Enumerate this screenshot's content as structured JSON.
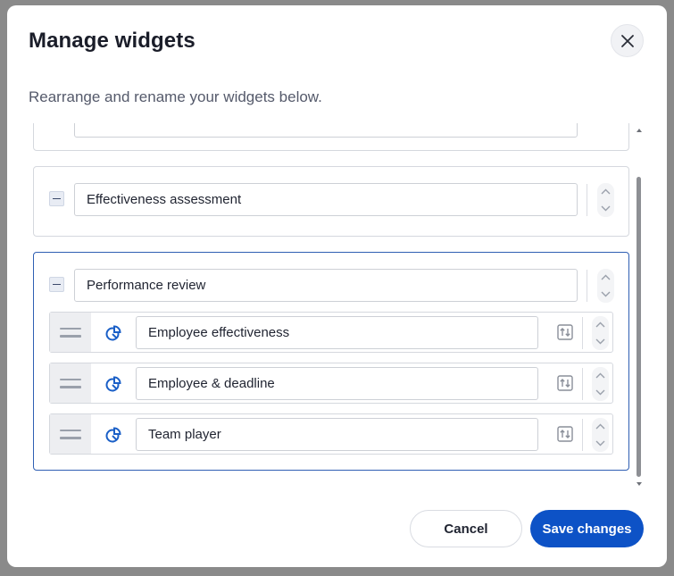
{
  "dialog": {
    "title": "Manage widgets",
    "subtitle": "Rearrange and rename your widgets below.",
    "close_icon": "close-icon"
  },
  "cards": [
    {
      "name": "",
      "partially_visible": true
    },
    {
      "name": "Effectiveness assessment"
    },
    {
      "name": "Performance review",
      "active": true,
      "widgets": [
        {
          "name": "Employee effectiveness",
          "icon": "pie-chart-icon"
        },
        {
          "name": "Employee & deadline",
          "icon": "pie-chart-icon"
        },
        {
          "name": "Team player",
          "icon": "pie-chart-icon"
        }
      ]
    }
  ],
  "footer": {
    "cancel_label": "Cancel",
    "save_label": "Save changes"
  },
  "colors": {
    "primary": "#0d52c6",
    "active_border": "#2f5fb3",
    "icon_blue": "#1a5fc7"
  }
}
